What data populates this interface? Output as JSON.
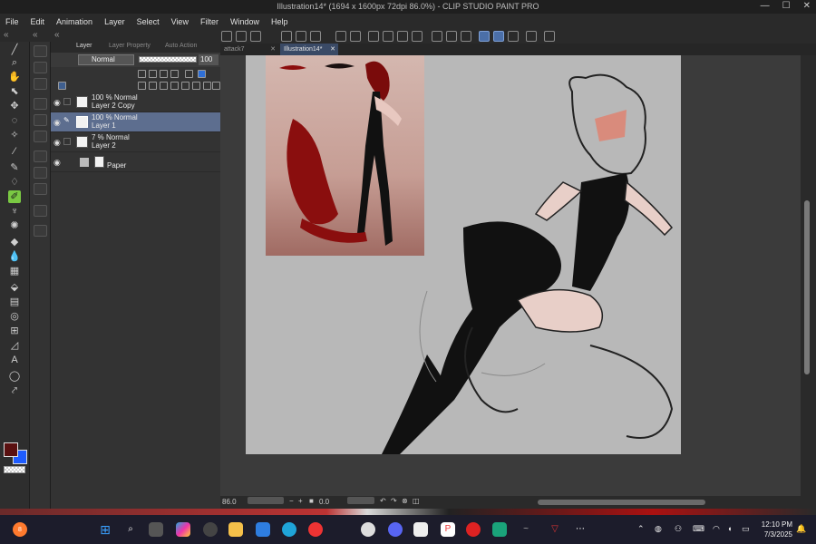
{
  "window": {
    "title": "Illustration14* (1694 x 1600px 72dpi 86.0%) - CLIP STUDIO PAINT PRO"
  },
  "menu": [
    "File",
    "Edit",
    "Animation",
    "Layer",
    "Select",
    "View",
    "Filter",
    "Window",
    "Help"
  ],
  "layer_panel": {
    "tabs": [
      "Layer",
      "Layer Property",
      "Auto Action"
    ],
    "blend_mode": "Normal",
    "opacity": "100",
    "layers": [
      {
        "line1": "100 % Normal",
        "line2": "Layer 2 Copy",
        "selected": false
      },
      {
        "line1": "100 % Normal",
        "line2": "Layer 1",
        "selected": true
      },
      {
        "line1": "7 % Normal",
        "line2": "Layer 2",
        "selected": false
      },
      {
        "line1": "",
        "line2": "Paper",
        "selected": false
      }
    ]
  },
  "document_tabs": [
    {
      "label": "attack7",
      "active": false
    },
    {
      "label": "Illustration14*",
      "active": true
    }
  ],
  "status": {
    "zoom": "86.0",
    "rotation": "0.0"
  },
  "colors": {
    "main": "#5a1010",
    "sub": "#1e5cff",
    "selected_tool": "#7ac943",
    "selected_layer": "#5d6e8f"
  },
  "taskbar": {
    "time": "12:10 PM",
    "date": "7/3/2025",
    "notification_count": "8"
  }
}
